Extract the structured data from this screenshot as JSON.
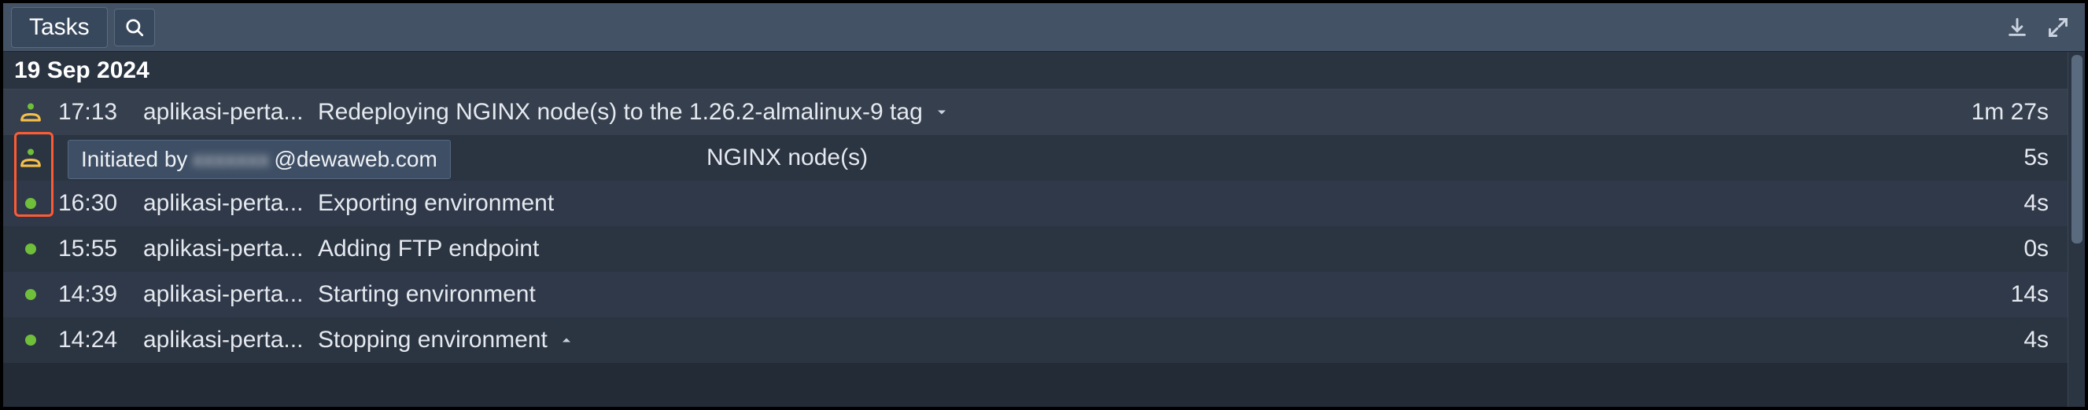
{
  "header": {
    "tab_label": "Tasks"
  },
  "date_header": "19 Sep 2024",
  "tooltip": {
    "prefix": "Initiated by",
    "blurred": "xxxxxxx",
    "suffix": "@dewaweb.com"
  },
  "tasks": [
    {
      "icon": "human",
      "time": "17:13",
      "env": "aplikasi-perta...",
      "desc": "Redeploying NGINX node(s) to the 1.26.2-almalinux-9 tag",
      "trailing_desc": "",
      "caret": "down",
      "duration": "1m 27s",
      "alt": "alt0",
      "has_tooltip": false
    },
    {
      "icon": "human",
      "time": "",
      "env": "",
      "desc": "",
      "trailing_desc": "NGINX node(s)",
      "caret": "",
      "duration": "5s",
      "alt": "alt1",
      "has_tooltip": true
    },
    {
      "icon": "dot",
      "time": "16:30",
      "env": "aplikasi-perta...",
      "desc": "Exporting environment",
      "trailing_desc": "",
      "caret": "",
      "duration": "4s",
      "alt": "alt2",
      "has_tooltip": false
    },
    {
      "icon": "dot",
      "time": "15:55",
      "env": "aplikasi-perta...",
      "desc": "Adding FTP endpoint",
      "trailing_desc": "",
      "caret": "",
      "duration": "0s",
      "alt": "alt1",
      "has_tooltip": false
    },
    {
      "icon": "dot",
      "time": "14:39",
      "env": "aplikasi-perta...",
      "desc": "Starting environment",
      "trailing_desc": "",
      "caret": "",
      "duration": "14s",
      "alt": "alt2",
      "has_tooltip": false
    },
    {
      "icon": "dot",
      "time": "14:24",
      "env": "aplikasi-perta...",
      "desc": "Stopping environment",
      "trailing_desc": "",
      "caret": "up",
      "duration": "4s",
      "alt": "alt1",
      "has_tooltip": false
    }
  ]
}
